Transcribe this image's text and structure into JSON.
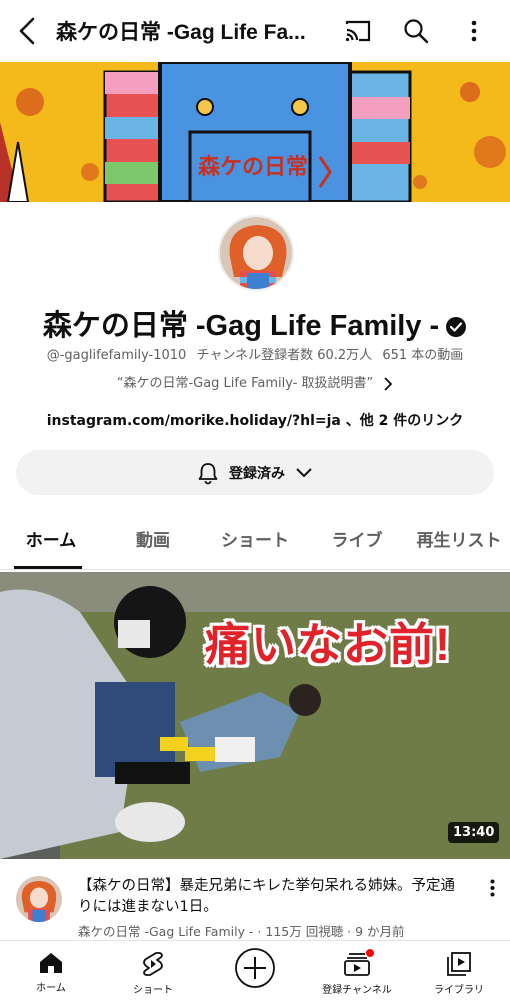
{
  "header": {
    "title": "森ケの日常 -Gag Life Fa...",
    "icons": [
      "back-icon",
      "cast-icon",
      "search-icon",
      "more-vert-icon"
    ]
  },
  "banner": {
    "logo_text": "森ケの日常"
  },
  "channel": {
    "name": "森ケの日常 -Gag Life Family -",
    "handle": "@-gaglifefamily-1010",
    "subscribers": "チャンネル登録者数 60.2万人",
    "videos": "651 本の動画",
    "description": "“森ケの日常-Gag Life Family- 取扱説明書”",
    "link": "instagram.com/morike.holiday/?hl=ja 、他 2 件のリンク",
    "subscribe_label": "登録済み"
  },
  "tabs": [
    {
      "label": "ホーム",
      "active": true
    },
    {
      "label": "動画",
      "active": false
    },
    {
      "label": "ショート",
      "active": false
    },
    {
      "label": "ライブ",
      "active": false
    },
    {
      "label": "再生リスト",
      "active": false
    }
  ],
  "video": {
    "overlay_text": "痛いなお前!",
    "duration": "13:40",
    "title": "【森ケの日常】暴走兄弟にキレた挙句呆れる姉妹。予定通りには進まない1日。",
    "meta": "森ケの日常 -Gag Life Family - · 115万 回視聴 · 9 か月前"
  },
  "bottom_nav": [
    {
      "label": "ホーム",
      "icon": "home-icon"
    },
    {
      "label": "ショート",
      "icon": "shorts-icon"
    },
    {
      "label": "",
      "icon": "create-icon"
    },
    {
      "label": "登録チャンネル",
      "icon": "subscriptions-icon"
    },
    {
      "label": "ライブラリ",
      "icon": "library-icon"
    }
  ],
  "colors": {
    "accent": "#0f0f0f",
    "muted": "#606060",
    "notification": "#ff0000",
    "banner_bg": "#f4b91a",
    "overlay_red": "#e0232a"
  }
}
